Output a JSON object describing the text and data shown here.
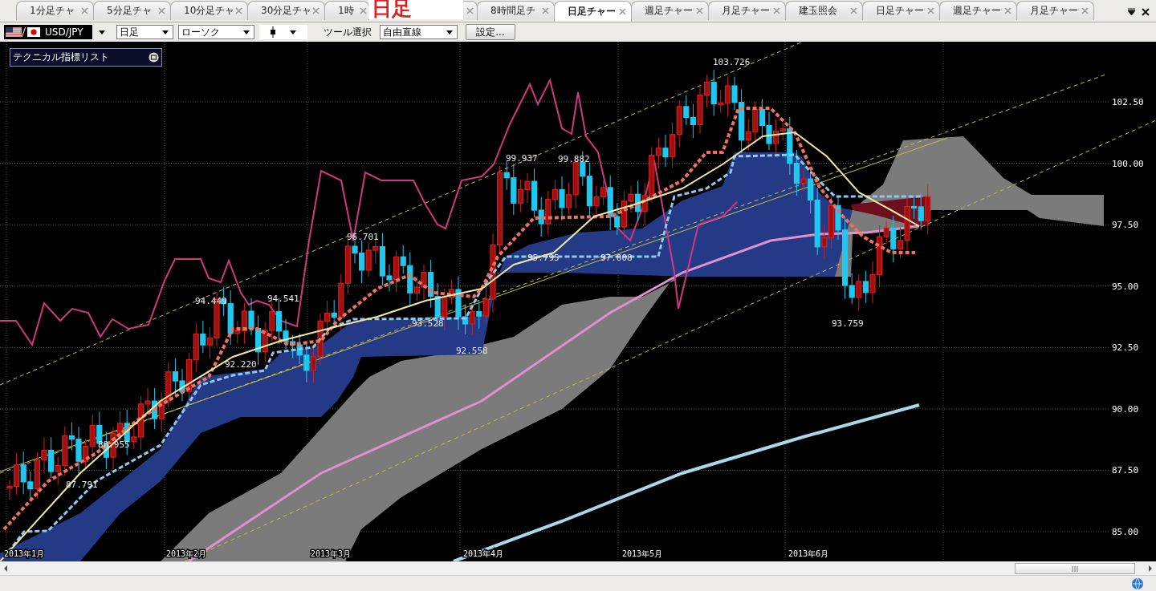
{
  "tabs": [
    {
      "label": "1分足チャ",
      "selected": false
    },
    {
      "label": "5分足チャ",
      "selected": false
    },
    {
      "label": "10分足チャ",
      "selected": false
    },
    {
      "label": "30分足チャ",
      "selected": false
    },
    {
      "label": "1時",
      "selected": false
    },
    {
      "selected": false
    },
    {
      "label": "8時間足チ",
      "selected": false
    },
    {
      "label": "日足チャー",
      "selected": true
    },
    {
      "label": "週足チャー",
      "selected": false
    },
    {
      "label": "月足チャー",
      "selected": false
    },
    {
      "label": "建玉照会",
      "selected": false
    },
    {
      "label": "日足チャー",
      "selected": false
    },
    {
      "label": "週足チャー",
      "selected": false
    },
    {
      "label": "月足チャー",
      "selected": false
    }
  ],
  "overlay_caption": "日足",
  "toolbar": {
    "symbol": "USD/JPY",
    "period": "日足",
    "chart_type": "ローソク",
    "tool_label": "ツール選択",
    "tool": "自由直線",
    "settings_button": "設定..."
  },
  "indicator_panel": {
    "title": "テクニカル指標リスト"
  },
  "chart": {
    "y_labels": [
      "102.50",
      "100.00",
      "97.50",
      "95.00",
      "92.50",
      "90.00",
      "87.50",
      "85.00"
    ],
    "x_labels": [
      "2013年1月",
      "2013年2月",
      "2013年3月",
      "2013年4月",
      "2013年5月",
      "2013年6月"
    ],
    "price_labels": [
      "103.726",
      "99.937",
      "99.882",
      "96.701",
      "94.449",
      "94.541",
      "93.528",
      "92.558",
      "92.220",
      "97.008",
      "95.795",
      "87.791",
      "88.955",
      "93.759"
    ]
  }
}
